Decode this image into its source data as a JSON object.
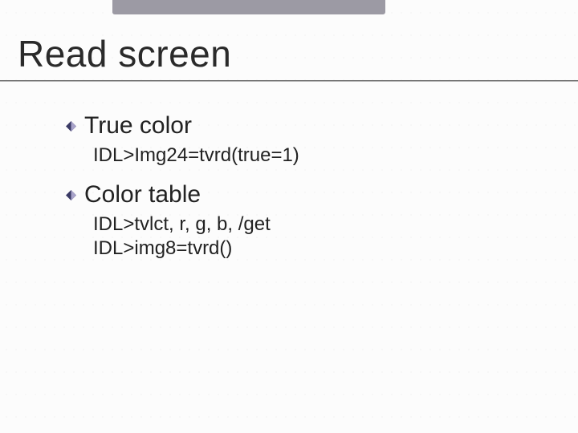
{
  "title": "Read screen",
  "colors": {
    "topbar": "#9c9aa4",
    "bullet_dark": "#3a3a65",
    "bullet_light": "#a7a2c9"
  },
  "content": {
    "section1": {
      "heading": "True color",
      "lines": [
        "IDL>Img24=tvrd(true=1)"
      ]
    },
    "section2": {
      "heading": "Color table",
      "lines": [
        "IDL>tvlct, r, g, b, /get",
        "IDL>img8=tvrd()"
      ]
    }
  }
}
